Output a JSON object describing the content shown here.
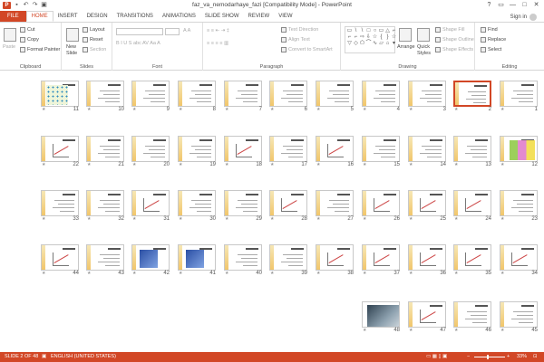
{
  "window": {
    "title": "faz_va_nemodarhaye_fazi [Compatibility Mode] - PowerPoint",
    "app_icon": "P",
    "controls": [
      "?",
      "▭",
      "—",
      "□",
      "✕"
    ]
  },
  "ribbon_tabs": [
    "FILE",
    "HOME",
    "INSERT",
    "DESIGN",
    "TRANSITIONS",
    "ANIMATIONS",
    "SLIDE SHOW",
    "REVIEW",
    "VIEW"
  ],
  "active_tab": "HOME",
  "signin": "Sign in",
  "clipboard": {
    "paste": "Paste",
    "cut": "Cut",
    "copy": "Copy",
    "format_painter": "Format Painter",
    "label": "Clipboard"
  },
  "slides_group": {
    "new_slide": "New",
    "new_slide2": "Slide",
    "layout": "Layout",
    "reset": "Reset",
    "section": "Section",
    "label": "Slides"
  },
  "font_group": {
    "label": "Font"
  },
  "paragraph_group": {
    "text_direction": "Text Direction",
    "align_text": "Align Text",
    "convert": "Convert to SmartArt",
    "label": "Paragraph"
  },
  "drawing_group": {
    "arrange": "Arrange",
    "quick_styles": "Quick",
    "quick_styles2": "Styles",
    "shape_fill": "Shape Fill",
    "shape_outline": "Shape Outline",
    "shape_effects": "Shape Effects",
    "label": "Drawing"
  },
  "editing_group": {
    "find": "Find",
    "replace": "Replace",
    "select": "Select",
    "label": "Editing"
  },
  "slides": [
    {
      "n": "11",
      "kind": "dots"
    },
    {
      "n": "10",
      "kind": "text"
    },
    {
      "n": "9",
      "kind": "text"
    },
    {
      "n": "8",
      "kind": "text"
    },
    {
      "n": "7",
      "kind": "text"
    },
    {
      "n": "6",
      "kind": "text"
    },
    {
      "n": "5",
      "kind": "text"
    },
    {
      "n": "4",
      "kind": "text"
    },
    {
      "n": "3",
      "kind": "text"
    },
    {
      "n": "2",
      "kind": "text",
      "selected": true
    },
    {
      "n": "1",
      "kind": "text"
    },
    {
      "n": "22",
      "kind": "graph"
    },
    {
      "n": "21",
      "kind": "text"
    },
    {
      "n": "20",
      "kind": "text"
    },
    {
      "n": "19",
      "kind": "text"
    },
    {
      "n": "18",
      "kind": "graph"
    },
    {
      "n": "17",
      "kind": "text"
    },
    {
      "n": "16",
      "kind": "graph"
    },
    {
      "n": "15",
      "kind": "text"
    },
    {
      "n": "14",
      "kind": "text"
    },
    {
      "n": "13",
      "kind": "text"
    },
    {
      "n": "12",
      "kind": "color"
    },
    {
      "n": "33",
      "kind": "text"
    },
    {
      "n": "32",
      "kind": "text"
    },
    {
      "n": "31",
      "kind": "graph"
    },
    {
      "n": "30",
      "kind": "text"
    },
    {
      "n": "29",
      "kind": "text"
    },
    {
      "n": "28",
      "kind": "graph"
    },
    {
      "n": "27",
      "kind": "text"
    },
    {
      "n": "26",
      "kind": "graph"
    },
    {
      "n": "25",
      "kind": "graph"
    },
    {
      "n": "24",
      "kind": "graph"
    },
    {
      "n": "23",
      "kind": "text"
    },
    {
      "n": "44",
      "kind": "graph"
    },
    {
      "n": "43",
      "kind": "text"
    },
    {
      "n": "42",
      "kind": "blue"
    },
    {
      "n": "41",
      "kind": "blue"
    },
    {
      "n": "40",
      "kind": "text"
    },
    {
      "n": "39",
      "kind": "text"
    },
    {
      "n": "38",
      "kind": "graph"
    },
    {
      "n": "37",
      "kind": "graph"
    },
    {
      "n": "36",
      "kind": "graph"
    },
    {
      "n": "35",
      "kind": "graph"
    },
    {
      "n": "34",
      "kind": "graph"
    },
    {
      "n": "48",
      "kind": "photo"
    },
    {
      "n": "47",
      "kind": "graph"
    },
    {
      "n": "46",
      "kind": "text"
    },
    {
      "n": "45",
      "kind": "text"
    }
  ],
  "status": {
    "slide_of": "SLIDE 2 OF 48",
    "language": "ENGLISH (UNITED STATES)",
    "zoom": "33%"
  }
}
